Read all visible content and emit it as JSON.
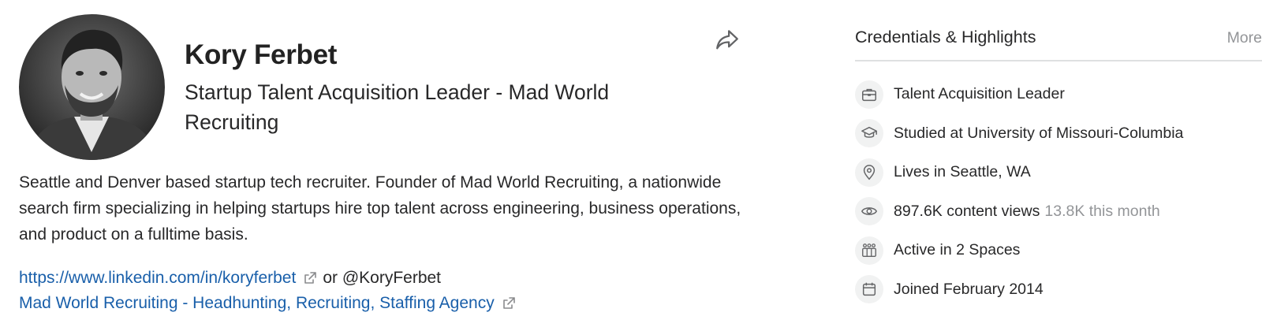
{
  "profile": {
    "name": "Kory Ferbet",
    "headline": "Startup Talent Acquisition Leader - Mad World Recruiting",
    "bio": "Seattle and Denver based startup tech recruiter. Founder of Mad World Recruiting, a nationwide search firm specializing in helping startups hire top talent across engineering, business operations, and product on a fulltime basis.",
    "links": [
      {
        "text": "https://www.linkedin.com/in/koryferbet",
        "suffix": "or @KoryFerbet"
      },
      {
        "text": "Mad World Recruiting - Headhunting, Recruiting, Staffing Agency",
        "suffix": ""
      }
    ]
  },
  "credentials": {
    "title": "Credentials & Highlights",
    "more_label": "More",
    "items": [
      {
        "icon": "briefcase-icon",
        "text": "Talent Acquisition Leader",
        "secondary": ""
      },
      {
        "icon": "graduation-cap-icon",
        "text": "Studied at University of Missouri-Columbia",
        "secondary": ""
      },
      {
        "icon": "location-pin-icon",
        "text": "Lives in Seattle, WA",
        "secondary": ""
      },
      {
        "icon": "eye-icon",
        "text": "897.6K content views",
        "secondary": "13.8K this month"
      },
      {
        "icon": "spaces-icon",
        "text": "Active in 2 Spaces",
        "secondary": ""
      },
      {
        "icon": "calendar-icon",
        "text": "Joined February 2014",
        "secondary": ""
      }
    ]
  },
  "icons": {
    "share": "share-icon",
    "external_link": "external-link-icon"
  },
  "colors": {
    "link": "#195faa",
    "text": "#282829",
    "muted": "#939598",
    "divider": "#dee0e1",
    "icon_bg": "#f1f2f2"
  }
}
